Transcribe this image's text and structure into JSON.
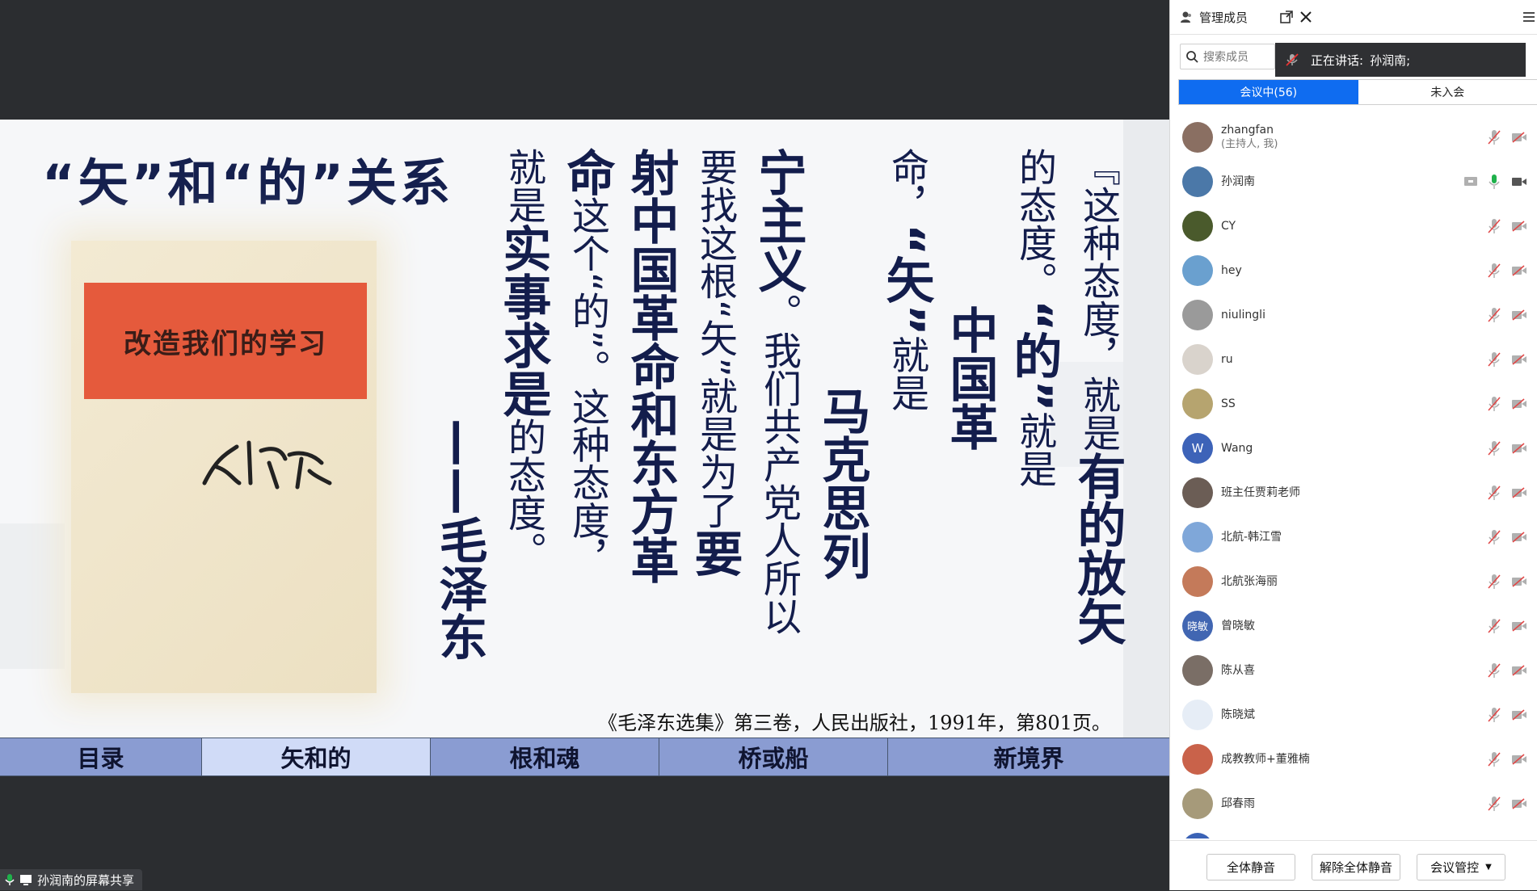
{
  "slide": {
    "title": "“矢”和“的”关系",
    "book_label": "改造我们的学习",
    "book_signature": "毛泽东",
    "quote_columns": [
      [
        "『这种态度，就是",
        "有的放矢",
        ""
      ],
      [
        "的态度。",
        "“的”",
        "就是"
      ],
      [
        "",
        "中国革",
        ""
      ],
      [
        "命，",
        "“矢”",
        "就是"
      ],
      [
        "",
        "马克思列",
        ""
      ],
      [
        "",
        "宁主义",
        "。我们共产党人所以"
      ],
      [
        "要找这根“矢”就是为了",
        "要",
        ""
      ],
      [
        "",
        "射中国革命和东方革",
        ""
      ],
      [
        "",
        "命",
        "这个“的”。这种态度，"
      ],
      [
        "就是",
        "实事求是",
        "的态度。"
      ],
      [
        "",
        "——毛泽东",
        ""
      ]
    ],
    "citation": "《毛泽东选集》第三卷，人民出版社，1991年，第801页。",
    "nav_tabs": [
      "目录",
      "矢和的",
      "根和魂",
      "桥或船",
      "新境界"
    ],
    "active_tab": 1
  },
  "share_status": "孙润南的屏幕共享",
  "panel": {
    "title": "管理成员",
    "search_placeholder": "搜索成员",
    "speaking_label": "正在讲话:",
    "speaking_name": "孙润南;",
    "tab_in_meeting": "会议中(56)",
    "tab_not_joined": "未入会",
    "participants": [
      {
        "name": "zhangfan",
        "sub": "(主持人, 我)",
        "avatar_color": "#8a6f62"
      },
      {
        "name": "孙润南",
        "sub": "",
        "avatar_color": "#4b78a8",
        "speaking": true
      },
      {
        "name": "CY",
        "sub": "",
        "avatar_color": "#4a5a2c"
      },
      {
        "name": "hey",
        "sub": "",
        "avatar_color": "#6aa0cf"
      },
      {
        "name": "niulingli",
        "sub": "",
        "avatar_color": "#9a9a9a"
      },
      {
        "name": "ru",
        "sub": "",
        "avatar_color": "#d9d3cc"
      },
      {
        "name": "SS",
        "sub": "",
        "avatar_color": "#b6a46f"
      },
      {
        "name": "Wang",
        "sub": "",
        "avatar_color": "#3d63b8",
        "initial": "W"
      },
      {
        "name": "班主任贾莉老师",
        "sub": "",
        "avatar_color": "#6b5d55"
      },
      {
        "name": "北航-韩江雪",
        "sub": "",
        "avatar_color": "#7fa7d9"
      },
      {
        "name": "北航张海丽",
        "sub": "",
        "avatar_color": "#c47a5a"
      },
      {
        "name": "曾晓敏",
        "sub": "",
        "avatar_color": "#4166b2",
        "initial": "晓敏"
      },
      {
        "name": "陈从喜",
        "sub": "",
        "avatar_color": "#7a6e66"
      },
      {
        "name": "陈晓斌",
        "sub": "",
        "avatar_color": "#e6edf6"
      },
      {
        "name": "成教教师+董雅楠",
        "sub": "",
        "avatar_color": "#c9624a"
      },
      {
        "name": "邱春雨",
        "sub": "",
        "avatar_color": "#a69a7a"
      },
      {
        "name": "",
        "sub": "",
        "avatar_color": "#3b63b6"
      }
    ],
    "footer_mute_all": "全体静音",
    "footer_unmute_all": "解除全体静音",
    "footer_control": "会议管控"
  },
  "colors": {
    "accent": "#0f6cf0",
    "mic_active": "#1fb14b",
    "muted_icon": "#b0b0b0"
  }
}
